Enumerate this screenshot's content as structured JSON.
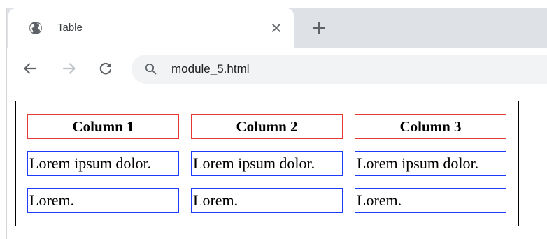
{
  "browser": {
    "tab": {
      "title": "Table",
      "favicon": "globe-icon",
      "close_icon": "close-icon"
    },
    "new_tab_icon": "plus-icon",
    "toolbar": {
      "back_icon": "arrow-left-icon",
      "forward_icon": "arrow-right-icon",
      "reload_icon": "reload-icon",
      "address": "module_5.html",
      "address_icon": "search-icon"
    }
  },
  "table": {
    "border_color": "#000000",
    "header_border_color": "#e53935",
    "cell_border_color": "#1e3cff",
    "headers": [
      "Column 1",
      "Column 2",
      "Column 3"
    ],
    "rows": [
      [
        "Lorem ipsum dolor.",
        "Lorem ipsum dolor.",
        "Lorem ipsum dolor."
      ],
      [
        "Lorem.",
        "Lorem.",
        "Lorem."
      ]
    ]
  }
}
